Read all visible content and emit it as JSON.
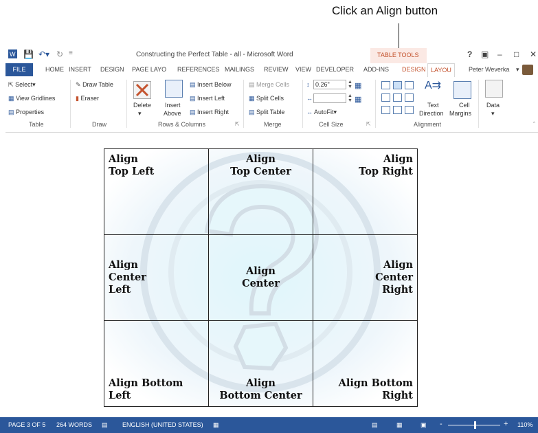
{
  "callout": "Click an Align button",
  "titlebar": {
    "title": "Constructing the Perfect Table - all - Microsoft Word",
    "table_tools": "TABLE TOOLS",
    "help": "?"
  },
  "tabs": [
    {
      "label": "FILE"
    },
    {
      "label": "HOME"
    },
    {
      "label": "INSERT"
    },
    {
      "label": "DESIGN"
    },
    {
      "label": "PAGE LAYO"
    },
    {
      "label": "REFERENCES"
    },
    {
      "label": "MAILINGS"
    },
    {
      "label": "REVIEW"
    },
    {
      "label": "VIEW"
    },
    {
      "label": "DEVELOPER"
    },
    {
      "label": "ADD-INS"
    },
    {
      "label": "DESIGN"
    },
    {
      "label": "LAYOU"
    }
  ],
  "user": "Peter Weverka",
  "ribbon": {
    "table": {
      "select": "Select",
      "gridlines": "View Gridlines",
      "properties": "Properties",
      "label": "Table"
    },
    "draw": {
      "draw_table": "Draw Table",
      "eraser": "Eraser",
      "label": "Draw"
    },
    "rows_cols": {
      "delete": "Delete",
      "insert_above_1": "Insert",
      "insert_above_2": "Above",
      "insert_below": "Insert Below",
      "insert_left": "Insert Left",
      "insert_right": "Insert Right",
      "label": "Rows & Columns"
    },
    "merge": {
      "merge_cells": "Merge Cells",
      "split_cells": "Split Cells",
      "split_table": "Split Table",
      "label": "Merge"
    },
    "cell_size": {
      "height": "0.26\"",
      "width": "",
      "autofit": "AutoFit",
      "label": "Cell Size"
    },
    "alignment": {
      "text_dir_1": "Text",
      "text_dir_2": "Direction",
      "margins_1": "Cell",
      "margins_2": "Margins",
      "label": "Alignment"
    },
    "data": {
      "label": "Data"
    }
  },
  "table_cells": [
    [
      "Align\nTop Left",
      "Align\nTop Center",
      "Align\nTop Right"
    ],
    [
      "Align\nCenter\nLeft",
      "Align\nCenter",
      "Align\nCenter\nRight"
    ],
    [
      "Align Bottom\nLeft",
      "Align\nBottom Center",
      "Align Bottom\nRight"
    ]
  ],
  "status": {
    "page": "PAGE 3 OF 5",
    "words": "264 WORDS",
    "language": "ENGLISH (UNITED STATES)",
    "zoom": "110%",
    "zoom_minus": "-",
    "zoom_plus": "+"
  }
}
